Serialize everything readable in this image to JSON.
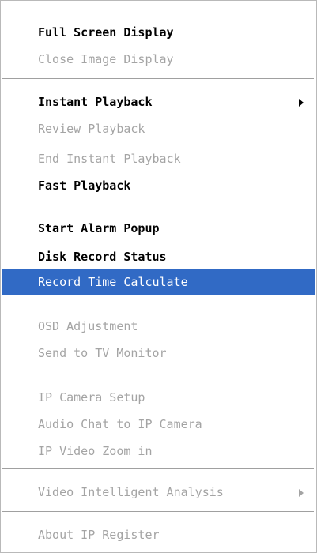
{
  "menu": {
    "items": [
      {
        "label": "Full Screen Display",
        "enabled": true
      },
      {
        "label": "Close Image Display",
        "enabled": false
      },
      {
        "label": "Instant Playback",
        "enabled": true,
        "submenu": true
      },
      {
        "label": "Review Playback",
        "enabled": false
      },
      {
        "label": "End Instant Playback",
        "enabled": false
      },
      {
        "label": "Fast Playback",
        "enabled": true
      },
      {
        "label": "Start Alarm Popup",
        "enabled": true
      },
      {
        "label": "Disk Record Status",
        "enabled": true
      },
      {
        "label": "Record Time Calculate",
        "enabled": true,
        "selected": true
      },
      {
        "label": "OSD Adjustment",
        "enabled": false
      },
      {
        "label": "Send to TV Monitor",
        "enabled": false
      },
      {
        "label": "IP Camera Setup",
        "enabled": false
      },
      {
        "label": "Audio Chat to IP Camera",
        "enabled": false
      },
      {
        "label": "IP Video Zoom in",
        "enabled": false
      },
      {
        "label": "Video Intelligent Analysis",
        "enabled": false,
        "submenu": true
      },
      {
        "label": "About IP Register",
        "enabled": false
      }
    ],
    "icons": {
      "submenu_arrow": "triangle-right-icon"
    },
    "colors": {
      "enabled_text": "#000000",
      "disabled_text": "#a4a4a4",
      "highlight_bg": "#316ac5",
      "highlight_text": "#ffffff"
    }
  }
}
